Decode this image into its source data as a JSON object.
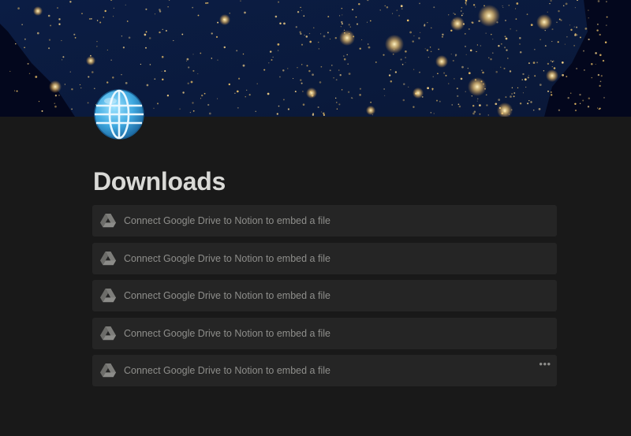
{
  "page": {
    "title": "Downloads",
    "icon": "globe-with-meridians-icon"
  },
  "cover": {
    "description_icon": "night-earth-map-cover"
  },
  "embeds": [
    {
      "label": "Connect Google Drive to Notion to embed a file",
      "icon": "google-drive-icon"
    },
    {
      "label": "Connect Google Drive to Notion to embed a file",
      "icon": "google-drive-icon"
    },
    {
      "label": "Connect Google Drive to Notion to embed a file",
      "icon": "google-drive-icon"
    },
    {
      "label": "Connect Google Drive to Notion to embed a file",
      "icon": "google-drive-icon"
    },
    {
      "label": "Connect Google Drive to Notion to embed a file",
      "icon": "google-drive-icon",
      "more_button": "•••"
    }
  ],
  "colors": {
    "background": "#191919",
    "block": "#252525",
    "title": "#d9d9d6",
    "muted_text": "#8e8e8b"
  }
}
